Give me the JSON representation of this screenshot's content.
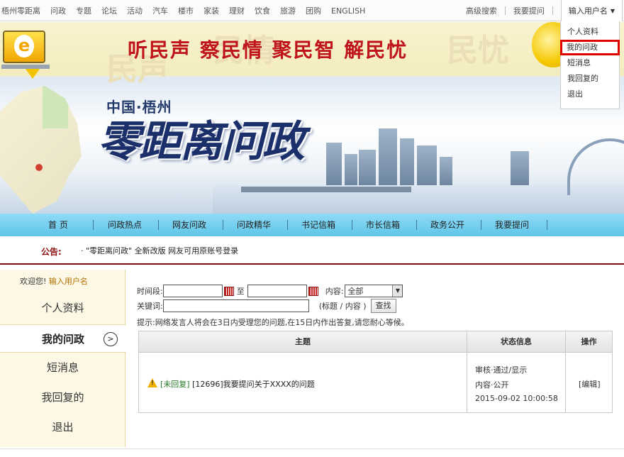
{
  "top_nav": {
    "left_links": [
      "梧州零距离",
      "问政",
      "专题",
      "论坛",
      "活动",
      "汽车",
      "楼市",
      "家装",
      "理财",
      "饮食",
      "旅游",
      "团购",
      "ENGLISH"
    ],
    "right_links": [
      "高级搜索",
      "我要提问"
    ],
    "user_menu_label": "输入用户名"
  },
  "user_dropdown": {
    "items": [
      "个人资料",
      "我的问政",
      "短消息",
      "我回复的",
      "退出"
    ],
    "active_index": 1
  },
  "banner": {
    "slogan": "听民声  察民情  聚民智  解民忧",
    "subtitle": "中国·梧州",
    "title": "零距离问政"
  },
  "main_nav": {
    "items": [
      "首  页",
      "问政热点",
      "网友问政",
      "问政精华",
      "书记信箱",
      "市长信箱",
      "政务公开",
      "我要提问"
    ]
  },
  "notice": {
    "label": "公告:",
    "text": "·  \"零距离问政\" 全新改版  网友可用原账号登录"
  },
  "sidebar": {
    "welcome_prefix": "欢迎您!",
    "username": "输入用户名",
    "items": [
      "个人资料",
      "我的问政",
      "短消息",
      "我回复的",
      "退出"
    ],
    "active_index": 1,
    "active_arrow": ">"
  },
  "filter": {
    "date_label": "时间段:",
    "date_from": "",
    "date_to_label": "至",
    "date_to": "",
    "scope_label": "内容:",
    "scope_value": "全部",
    "keyword_label": "关键词:",
    "keyword_value": "",
    "keyword_hint": "(标题 / 内容 )",
    "search_button": "查找",
    "tip": "提示:网络发言人将会在3日内受理您的问题,在15日内作出答复,请您耐心等候。"
  },
  "table": {
    "headers": [
      "主题",
      "状态信息",
      "操作"
    ],
    "rows": [
      {
        "tag": "[未回复]",
        "subject": "[12696]我要提问关于XXXX的问题",
        "status_lines": [
          "审核·通过/显示",
          "内容·公开",
          "2015-09-02 10:00:58"
        ],
        "action": "[编辑]"
      }
    ]
  }
}
